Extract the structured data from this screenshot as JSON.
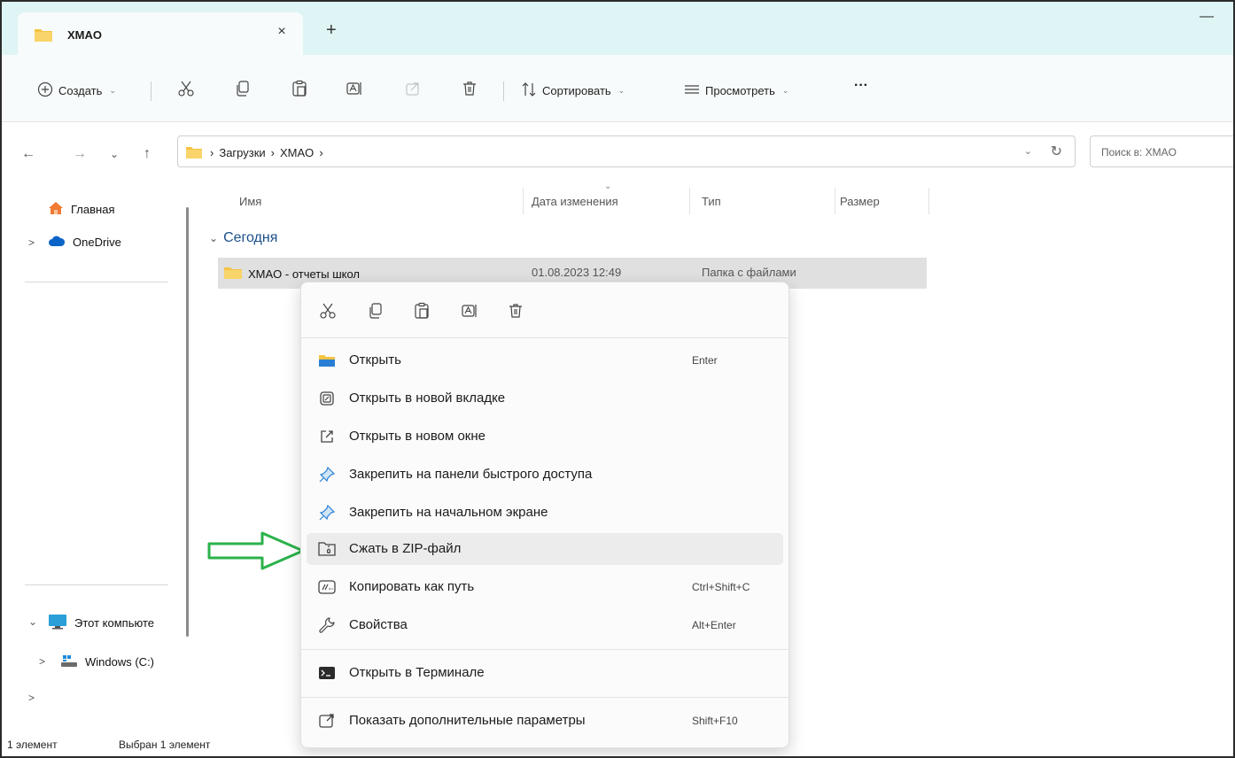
{
  "window": {
    "tab_title": "XMAO",
    "tab_close": "×",
    "new_tab": "+",
    "minimize": "—"
  },
  "toolbar": {
    "create_label": "Создать",
    "sort_label": "Сортировать",
    "view_label": "Просмотреть",
    "more_label": "···",
    "chevron": "⌄"
  },
  "address": {
    "crumbs": [
      "›",
      "Загрузки",
      "›",
      "XMAO",
      "›"
    ],
    "chevron": "⌄",
    "refresh": "↻",
    "search_placeholder": "Поиск в: XMAO",
    "nav_back": "←",
    "nav_forward": "→",
    "nav_recent": "⌄",
    "nav_up": "↑"
  },
  "sidebar": {
    "items": [
      {
        "label": "Главная",
        "icon": "home-icon"
      },
      {
        "label": "OneDrive",
        "icon": "cloud-icon",
        "chevron": ">"
      },
      {
        "label": "Этот компьюте",
        "icon": "computer-icon",
        "chevron": "⌄"
      },
      {
        "label": "Windows (C:)",
        "icon": "drive-icon",
        "chevron": ">"
      },
      {
        "label": "",
        "chevron": ">"
      }
    ]
  },
  "columns": {
    "name": "Имя",
    "date": "Дата изменения",
    "type": "Тип",
    "size": "Размер",
    "sort_caret": "⌄"
  },
  "content": {
    "group_chevron": "⌄",
    "group_label": "Сегодня",
    "row": {
      "name": "XMAO - отчеты школ",
      "date": "01.08.2023 12:49",
      "type": "Папка с файлами"
    }
  },
  "status": {
    "count": "1 элемент",
    "selected": "Выбран 1 элемент"
  },
  "context_menu": {
    "items": [
      {
        "label": "Открыть",
        "key": "Enter",
        "icon": "folder-open-icon"
      },
      {
        "label": "Открыть в новой вкладке",
        "key": "",
        "icon": "new-tab-icon"
      },
      {
        "label": "Открыть в новом окне",
        "key": "",
        "icon": "new-window-icon"
      },
      {
        "label": "Закрепить на панели быстрого доступа",
        "key": "",
        "icon": "pin-icon"
      },
      {
        "label": "Закрепить на начальном экране",
        "key": "",
        "icon": "pin-icon"
      },
      {
        "label": "Сжать в ZIP-файл",
        "key": "",
        "icon": "zip-icon"
      },
      {
        "label": "Копировать как путь",
        "key": "Ctrl+Shift+C",
        "icon": "copy-path-icon"
      },
      {
        "label": "Свойства",
        "key": "Alt+Enter",
        "icon": "wrench-icon"
      },
      {
        "label": "Открыть в Терминале",
        "key": "",
        "icon": "terminal-icon"
      },
      {
        "label": "Показать дополнительные параметры",
        "key": "Shift+F10",
        "icon": "more-options-icon"
      }
    ]
  },
  "colors": {
    "tabbar_bg": "#dff4f4",
    "annotation_arrow": "#2bb24c",
    "folder_yellow": "#f5c443",
    "group_blue": "#1b4f8a"
  }
}
